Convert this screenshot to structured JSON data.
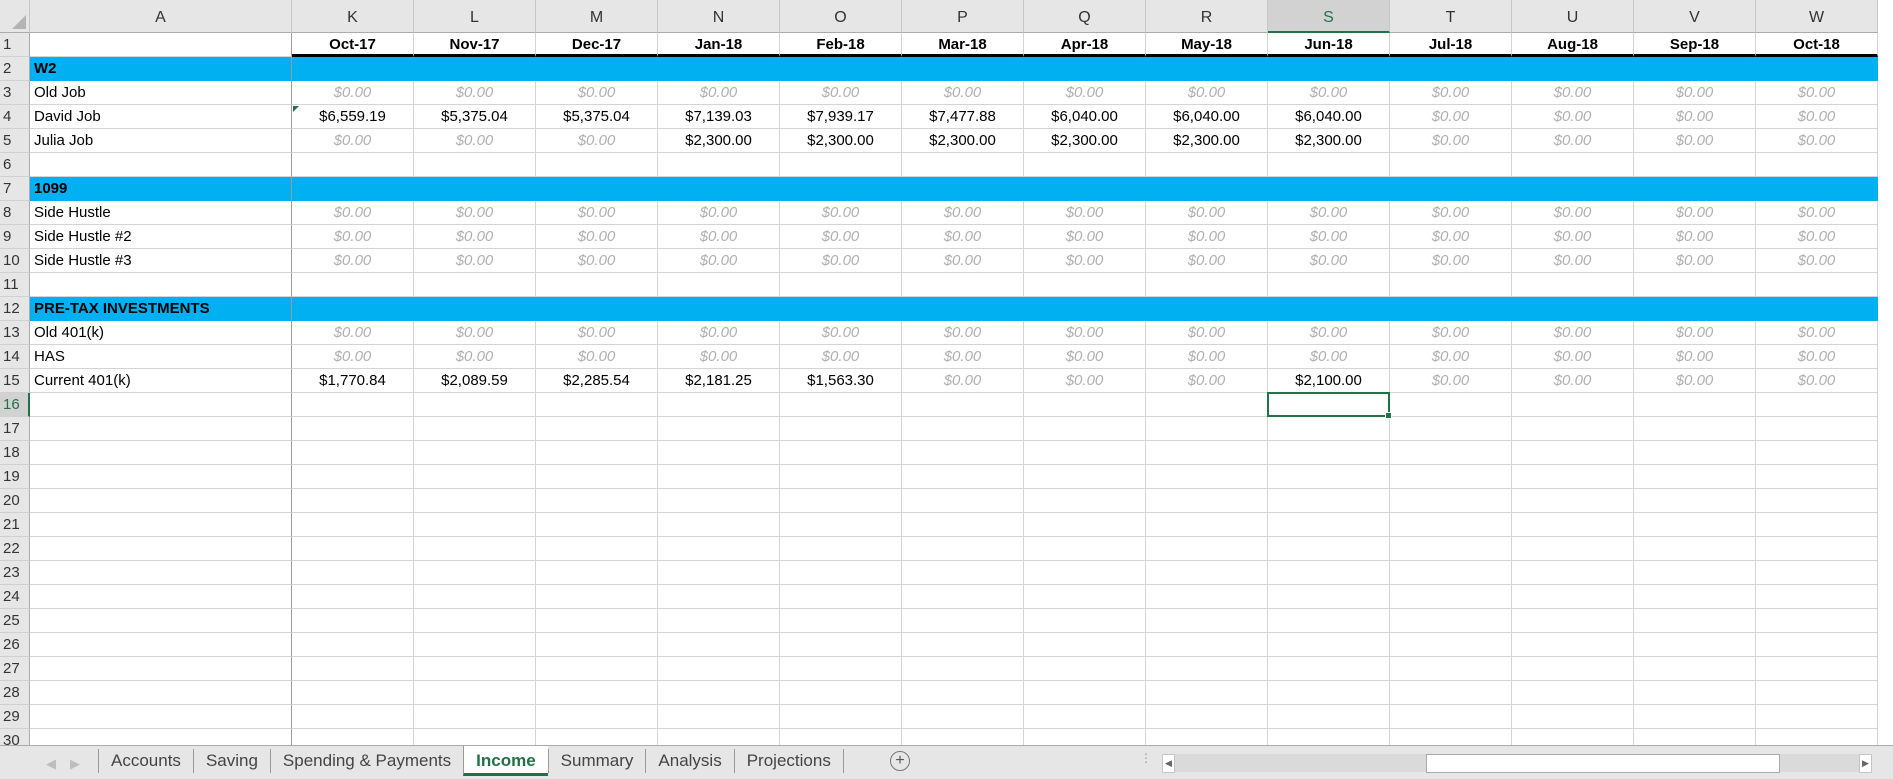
{
  "columns": {
    "row_header_col": "A",
    "letters": [
      "K",
      "L",
      "M",
      "N",
      "O",
      "P",
      "Q",
      "R",
      "S",
      "T",
      "U",
      "V",
      "W"
    ],
    "selected": "S"
  },
  "header_row": [
    "Oct-17",
    "Nov-17",
    "Dec-17",
    "Jan-18",
    "Feb-18",
    "Mar-18",
    "Apr-18",
    "May-18",
    "Jun-18",
    "Jul-18",
    "Aug-18",
    "Sep-18",
    "Oct-18"
  ],
  "rows": [
    {
      "num": "1",
      "type": "header",
      "label": ""
    },
    {
      "num": "2",
      "type": "section",
      "label": "W2"
    },
    {
      "num": "3",
      "type": "data",
      "label": "Old Job",
      "values": [
        "$0.00",
        "$0.00",
        "$0.00",
        "$0.00",
        "$0.00",
        "$0.00",
        "$0.00",
        "$0.00",
        "$0.00",
        "$0.00",
        "$0.00",
        "$0.00",
        "$0.00"
      ]
    },
    {
      "num": "4",
      "type": "data",
      "label": "David Job",
      "values": [
        "$6,559.19",
        "$5,375.04",
        "$5,375.04",
        "$7,139.03",
        "$7,939.17",
        "$7,477.88",
        "$6,040.00",
        "$6,040.00",
        "$6,040.00",
        "$0.00",
        "$0.00",
        "$0.00",
        "$0.00"
      ]
    },
    {
      "num": "5",
      "type": "data",
      "label": "Julia Job",
      "values": [
        "$0.00",
        "$0.00",
        "$0.00",
        "$2,300.00",
        "$2,300.00",
        "$2,300.00",
        "$2,300.00",
        "$2,300.00",
        "$2,300.00",
        "$0.00",
        "$0.00",
        "$0.00",
        "$0.00"
      ]
    },
    {
      "num": "6",
      "type": "empty",
      "label": ""
    },
    {
      "num": "7",
      "type": "section",
      "label": "1099"
    },
    {
      "num": "8",
      "type": "data",
      "label": "Side Hustle",
      "values": [
        "$0.00",
        "$0.00",
        "$0.00",
        "$0.00",
        "$0.00",
        "$0.00",
        "$0.00",
        "$0.00",
        "$0.00",
        "$0.00",
        "$0.00",
        "$0.00",
        "$0.00"
      ]
    },
    {
      "num": "9",
      "type": "data",
      "label": "Side Hustle #2",
      "values": [
        "$0.00",
        "$0.00",
        "$0.00",
        "$0.00",
        "$0.00",
        "$0.00",
        "$0.00",
        "$0.00",
        "$0.00",
        "$0.00",
        "$0.00",
        "$0.00",
        "$0.00"
      ]
    },
    {
      "num": "10",
      "type": "data",
      "label": "Side Hustle #3",
      "values": [
        "$0.00",
        "$0.00",
        "$0.00",
        "$0.00",
        "$0.00",
        "$0.00",
        "$0.00",
        "$0.00",
        "$0.00",
        "$0.00",
        "$0.00",
        "$0.00",
        "$0.00"
      ]
    },
    {
      "num": "11",
      "type": "empty",
      "label": ""
    },
    {
      "num": "12",
      "type": "section",
      "label": "PRE-TAX INVESTMENTS"
    },
    {
      "num": "13",
      "type": "data",
      "label": "Old 401(k)",
      "values": [
        "$0.00",
        "$0.00",
        "$0.00",
        "$0.00",
        "$0.00",
        "$0.00",
        "$0.00",
        "$0.00",
        "$0.00",
        "$0.00",
        "$0.00",
        "$0.00",
        "$0.00"
      ]
    },
    {
      "num": "14",
      "type": "data",
      "label": "HAS",
      "values": [
        "$0.00",
        "$0.00",
        "$0.00",
        "$0.00",
        "$0.00",
        "$0.00",
        "$0.00",
        "$0.00",
        "$0.00",
        "$0.00",
        "$0.00",
        "$0.00",
        "$0.00"
      ]
    },
    {
      "num": "15",
      "type": "data",
      "label": "Current 401(k)",
      "values": [
        "$1,770.84",
        "$2,089.59",
        "$2,285.54",
        "$2,181.25",
        "$1,563.30",
        "$0.00",
        "$0.00",
        "$0.00",
        "$2,100.00",
        "$0.00",
        "$0.00",
        "$0.00",
        "$0.00"
      ]
    },
    {
      "num": "16",
      "type": "empty",
      "label": ""
    },
    {
      "num": "17",
      "type": "empty",
      "label": ""
    },
    {
      "num": "18",
      "type": "empty",
      "label": ""
    },
    {
      "num": "19",
      "type": "empty",
      "label": ""
    },
    {
      "num": "20",
      "type": "empty",
      "label": ""
    },
    {
      "num": "21",
      "type": "empty",
      "label": ""
    },
    {
      "num": "22",
      "type": "empty",
      "label": ""
    },
    {
      "num": "23",
      "type": "empty",
      "label": ""
    },
    {
      "num": "24",
      "type": "empty",
      "label": ""
    },
    {
      "num": "25",
      "type": "empty",
      "label": ""
    },
    {
      "num": "26",
      "type": "empty",
      "label": ""
    },
    {
      "num": "27",
      "type": "empty",
      "label": ""
    },
    {
      "num": "28",
      "type": "empty",
      "label": ""
    },
    {
      "num": "29",
      "type": "empty",
      "label": ""
    },
    {
      "num": "30",
      "type": "empty",
      "label": ""
    }
  ],
  "selected_cell": {
    "col": "S",
    "row": "16"
  },
  "sheet_tabs": [
    {
      "label": "Accounts",
      "active": false
    },
    {
      "label": "Saving",
      "active": false
    },
    {
      "label": "Spending & Payments",
      "active": false
    },
    {
      "label": "Income",
      "active": true
    },
    {
      "label": "Summary",
      "active": false
    },
    {
      "label": "Analysis",
      "active": false
    },
    {
      "label": "Projections",
      "active": false
    }
  ],
  "add_sheet_symbol": "+",
  "colors": {
    "section_fill": "#00b0f0",
    "accent": "#217346",
    "zero_text": "#b0b0b0"
  }
}
